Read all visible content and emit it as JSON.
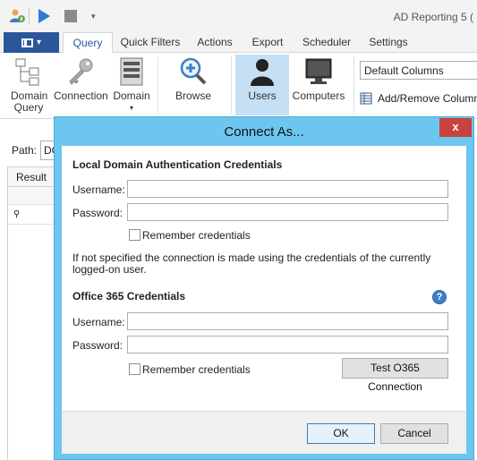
{
  "app": {
    "title": "AD Reporting 5 ("
  },
  "tabs": [
    {
      "label": "Query",
      "active": true
    },
    {
      "label": "Quick Filters",
      "active": false
    },
    {
      "label": "Actions",
      "active": false
    },
    {
      "label": "Export",
      "active": false
    },
    {
      "label": "Scheduler",
      "active": false
    },
    {
      "label": "Settings",
      "active": false
    }
  ],
  "ribbon": {
    "domain_query": "Domain Query",
    "connection": "Connection",
    "domain": "Domain",
    "domain_arrow": "▾",
    "browse": "Browse",
    "users": "Users",
    "computers": "Computers",
    "columns_select": "Default Columns",
    "add_remove": "Add/Remove Columns"
  },
  "path": {
    "label": "Path:",
    "value": "DC"
  },
  "results": {
    "header": "Result"
  },
  "dialog": {
    "title": "Connect As...",
    "close": "x",
    "local": {
      "heading": "Local Domain Authentication Credentials",
      "username_label": "Username:",
      "password_label": "Password:",
      "remember": "Remember credentials"
    },
    "note": "If not specified the connection is made using the credentials of the currently logged-on user.",
    "o365": {
      "heading": "Office 365 Credentials",
      "help": "?",
      "username_label": "Username:",
      "password_label": "Password:",
      "remember": "Remember credentials",
      "test_button": "Test O365 Connection"
    },
    "ok": "OK",
    "cancel": "Cancel"
  }
}
